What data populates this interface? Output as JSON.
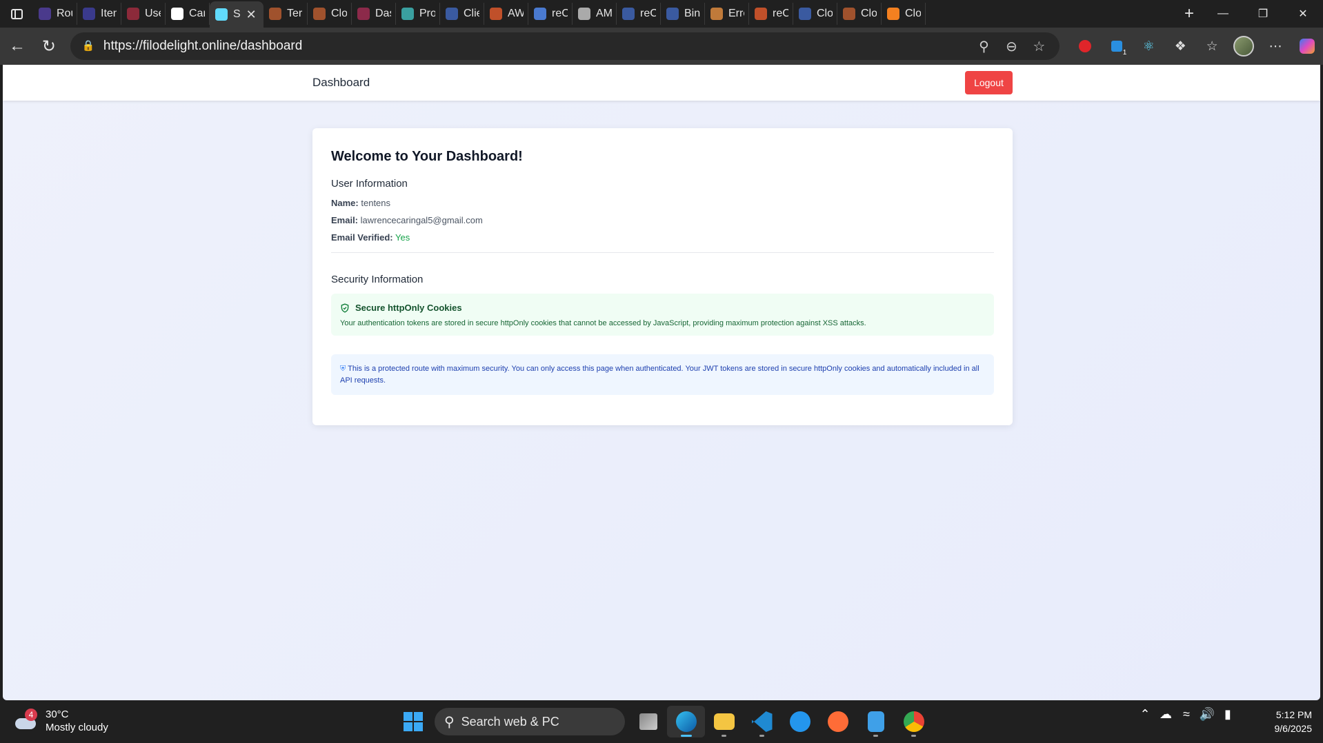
{
  "browser": {
    "tabs": [
      {
        "title": "Route",
        "icon": "app-icon",
        "color": "#4a3a8c"
      },
      {
        "title": "Items",
        "icon": "app-icon",
        "color": "#3a3a8c"
      },
      {
        "title": "Users",
        "icon": "app-icon",
        "color": "#8c2a3a"
      },
      {
        "title": "Carin",
        "icon": "github-icon",
        "color": "#ffffff"
      },
      {
        "title": "S",
        "icon": "react-icon",
        "color": "#61dafb",
        "active": true
      },
      {
        "title": "Terms",
        "icon": "cloud-icon",
        "color": "#a0522d"
      },
      {
        "title": "Cloud",
        "icon": "cloud-icon",
        "color": "#a0522d"
      },
      {
        "title": "Dasht",
        "icon": "app-icon",
        "color": "#8c2a4a"
      },
      {
        "title": "Produ",
        "icon": "leaf-icon",
        "color": "#3aa0a0"
      },
      {
        "title": "Client",
        "icon": "shield-icon",
        "color": "#3a5aa0"
      },
      {
        "title": "AWS",
        "icon": "star-icon",
        "color": "#c0502a"
      },
      {
        "title": "reCAI",
        "icon": "recaptcha-icon",
        "color": "#4a7ad0"
      },
      {
        "title": "AMP",
        "icon": "openai-icon",
        "color": "#aaaaaa"
      },
      {
        "title": "reCAI",
        "icon": "search-icon",
        "color": "#3a5aa0"
      },
      {
        "title": "Bing",
        "icon": "search-icon",
        "color": "#3a5aa0"
      },
      {
        "title": "Error:",
        "icon": "pen-icon",
        "color": "#c07a3a"
      },
      {
        "title": "reCAI",
        "icon": "star-icon",
        "color": "#c0502a"
      },
      {
        "title": "Cloud",
        "icon": "search-icon",
        "color": "#3a5aa0"
      },
      {
        "title": "Cloud",
        "icon": "cloud-icon",
        "color": "#a0522d"
      },
      {
        "title": "Cloud",
        "icon": "cloud-icon",
        "color": "#f38020"
      }
    ],
    "url": "https://filodelight.online/dashboard",
    "extension_badge": "1"
  },
  "app": {
    "brand": "Dashboard",
    "logout_label": "Logout"
  },
  "card": {
    "title": "Welcome to Your Dashboard!",
    "user_section_title": "User Information",
    "name_label": "Name:",
    "name_value": "tentens",
    "email_label": "Email:",
    "email_value": "lawrencecaringal5@gmail.com",
    "verified_label": "Email Verified:",
    "verified_value": "Yes",
    "security_section_title": "Security Information",
    "cookies_title": "Secure httpOnly Cookies",
    "cookies_text": "Your authentication tokens are stored in secure httpOnly cookies that cannot be accessed by JavaScript, providing maximum protection against XSS attacks.",
    "note_text": "This is a protected route with maximum security. You can only access this page when authenticated. Your JWT tokens are stored in secure httpOnly cookies and automatically included in all API requests."
  },
  "taskbar": {
    "weather_badge": "4",
    "temperature": "30°C",
    "condition": "Mostly cloudy",
    "search_placeholder": "Search web & PC",
    "time": "5:12 PM",
    "date": "9/6/2025"
  },
  "colors": {
    "accent_danger": "#ef4444",
    "success": "#16a34a",
    "info": "#1e40af"
  }
}
